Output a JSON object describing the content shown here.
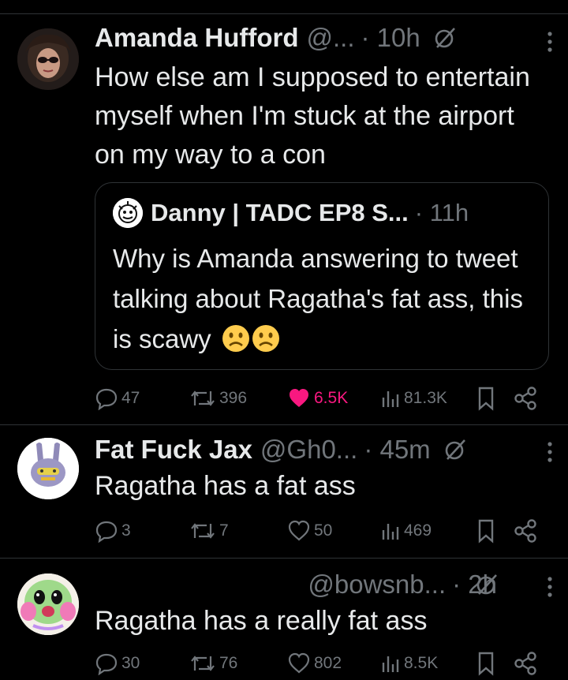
{
  "tweets": [
    {
      "name": "Amanda Hufford",
      "handle": "@...",
      "time": "· 10h",
      "text": "How else am I supposed to entertain myself when I'm stuck at the airport on my way to a con",
      "quote": {
        "name": "Danny | TADC EP8 S...",
        "time": "· 11h",
        "text": "Why is Amanda answering to tweet talking about Ragatha's fat ass, this is scawy"
      },
      "stats": {
        "replies": "47",
        "reposts": "396",
        "likes": "6.5K",
        "views": "81.3K"
      },
      "liked": true
    },
    {
      "name": "Fat Fuck Jax",
      "handle": "@Gh0...",
      "time": "· 45m",
      "text": "Ragatha has a fat ass",
      "stats": {
        "replies": "3",
        "reposts": "7",
        "likes": "50",
        "views": "469"
      },
      "liked": false
    },
    {
      "name": "",
      "handle": "@bowsnb...",
      "time": "· 2h",
      "text": "Ragatha has a really fat ass",
      "stats": {
        "replies": "30",
        "reposts": "76",
        "likes": "802",
        "views": "8.5K"
      },
      "liked": false
    }
  ],
  "colors": {
    "background": "#000000",
    "text": "#e7e9ea",
    "muted": "#71767b",
    "like": "#f91880",
    "border": "#2f3336"
  }
}
